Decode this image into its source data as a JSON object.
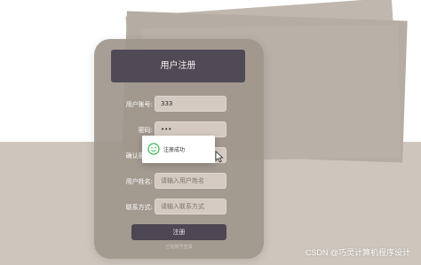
{
  "register_form": {
    "title": "用户注册",
    "fields": [
      {
        "label": "用户账号:",
        "value": "333",
        "placeholder": ""
      },
      {
        "label": "密码:",
        "value": "•••",
        "placeholder": ""
      },
      {
        "label": "确认密码:",
        "value": "",
        "placeholder": ""
      },
      {
        "label": "用户姓名:",
        "value": "",
        "placeholder": "请输入用户姓名"
      },
      {
        "label": "联系方式:",
        "value": "",
        "placeholder": "请输入联系方式"
      }
    ],
    "submit_label": "注册",
    "login_link": "已有账号登录"
  },
  "toast": {
    "icon": "smile-icon",
    "message": "注册成功"
  },
  "watermark": "CSDN @巧灵计算机程序设计",
  "colors": {
    "header_bg": "#4f4a55",
    "card_bg": "#a0968c",
    "toast_icon": "#39b54a"
  }
}
